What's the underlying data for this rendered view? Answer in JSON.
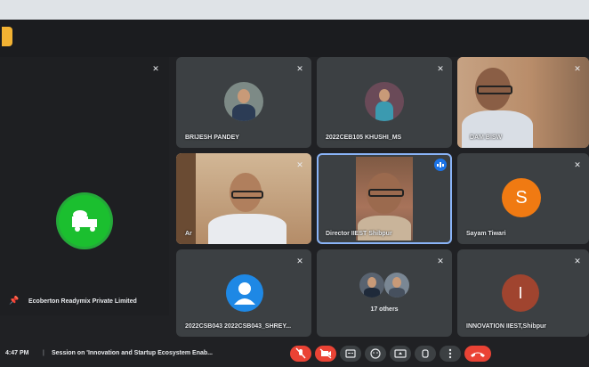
{
  "presenter": {
    "name": "Ecoberton Readymix Private Limited"
  },
  "tiles": {
    "t1": {
      "name": "BRIJESH PANDEY"
    },
    "t2": {
      "name": "2022CEB105 KHUSHI_MS"
    },
    "t3": {
      "name": "DAM BISW"
    },
    "t4": {
      "name": "Ar"
    },
    "t5": {
      "name": "Director IIEST Shibpur"
    },
    "t6": {
      "name": "Sayam Tiwari",
      "initial": "S",
      "color": "#f07a12"
    },
    "t7": {
      "name": "2022CSB043 2022CSB043_SHREY..."
    },
    "t8": {
      "count_label": "17 others"
    },
    "t9": {
      "name": "INNOVATION IIEST,Shibpur",
      "initial": "I",
      "color": "#a0442f"
    }
  },
  "bottombar": {
    "time": "4:47 PM",
    "separator": "|",
    "meeting_title": "Session on 'Innovation and Startup Ecosystem Enab..."
  },
  "controls": {
    "mic_icon": "mic-off-icon",
    "camera_icon": "camera-off-icon",
    "captions_icon": "captions-icon",
    "emoji_icon": "emoji-icon",
    "present_icon": "present-icon",
    "hand_icon": "raise-hand-icon",
    "more_icon": "more-options-icon",
    "leave_icon": "leave-call-icon"
  },
  "colors": {
    "accent_red": "#ea4335",
    "tile_bg": "#3c4043",
    "bg": "#202124",
    "google_blue": "#1a73e8"
  }
}
